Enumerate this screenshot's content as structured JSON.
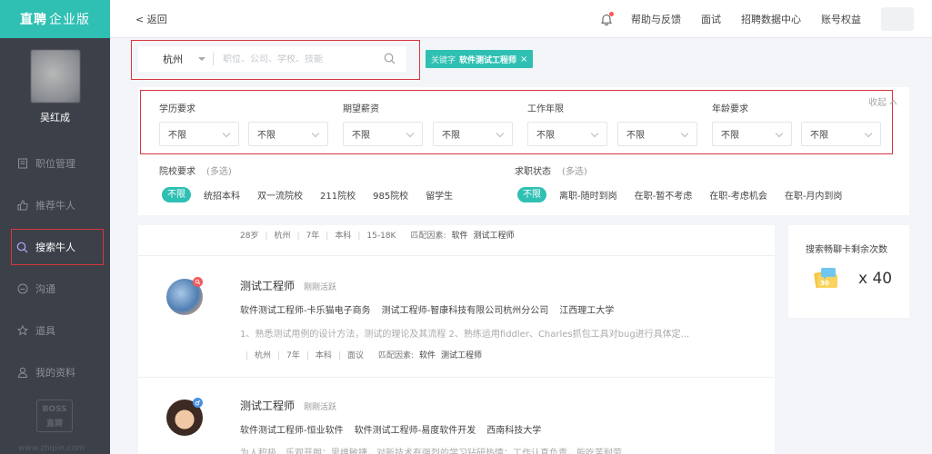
{
  "sidebar": {
    "brand_bold": "直聘",
    "brand_light": "企业版",
    "user_name": "吴红成",
    "items": [
      {
        "label": "职位管理",
        "icon": "document-icon"
      },
      {
        "label": "推荐牛人",
        "icon": "thumbs-up-icon"
      },
      {
        "label": "搜索牛人",
        "icon": "search-icon",
        "active": true
      },
      {
        "label": "沟通",
        "icon": "chat-icon"
      },
      {
        "label": "道具",
        "icon": "star-icon"
      },
      {
        "label": "我的资料",
        "icon": "user-icon"
      }
    ],
    "logo_line1": "BOSS",
    "logo_line2": "直聘",
    "footer_url": "www.zhipin.com"
  },
  "topbar": {
    "back": "< 返回",
    "links": [
      "帮助与反馈",
      "面试",
      "招聘数据中心",
      "账号权益"
    ],
    "bell_icon": "bell-icon"
  },
  "search": {
    "city": "杭州",
    "placeholder": "职位、公司、学校、技能",
    "keyword_label": "关键字",
    "keyword_value": "软件测试工程师",
    "keyword_close": "×"
  },
  "filters": {
    "collapse_label": "收起",
    "groups": [
      {
        "label": "学历要求",
        "selects": [
          "不限",
          "不限"
        ]
      },
      {
        "label": "期望薪资",
        "selects": [
          "不限",
          "不限"
        ]
      },
      {
        "label": "工作年限",
        "selects": [
          "不限",
          "不限"
        ]
      },
      {
        "label": "年龄要求",
        "selects": [
          "不限",
          "不限"
        ]
      }
    ],
    "school": {
      "label": "院校要求",
      "hint": "(多选)",
      "options": [
        "不限",
        "统招本科",
        "双一流院校",
        "211院校",
        "985院校",
        "留学生"
      ]
    },
    "status": {
      "label": "求职状态",
      "hint": "(多选)",
      "options": [
        "不限",
        "离职-随时到岗",
        "在职-暂不考虑",
        "在职-考虑机会",
        "在职-月内到岗"
      ]
    }
  },
  "results": {
    "partial_meta": {
      "age": "28岁",
      "city": "杭州",
      "years": "7年",
      "degree": "本科",
      "salary": "15-18K",
      "match_label": "匹配因素:",
      "keywords": [
        "软件",
        "测试工程师"
      ]
    },
    "candidates": [
      {
        "title": "测试工程师",
        "active": "刚刚活跃",
        "experience": [
          "软件测试工程师-卡乐猫电子商务",
          "测试工程师-智康科技有限公司杭州分公司",
          "江西理工大学"
        ],
        "description": "1、熟悉测试用例的设计方法，测试的理论及其流程 2、熟练运用fiddler、Charles抓包工具对bug进行具体定...",
        "meta": {
          "city": "杭州",
          "years": "7年",
          "degree": "本科",
          "salary": "面议",
          "match_label": "匹配因素:",
          "keywords": [
            "软件",
            "测试工程师"
          ]
        }
      },
      {
        "title": "测试工程师",
        "active": "刚刚活跃",
        "experience": [
          "软件测试工程师-恒业软件",
          "软件测试工程师-易度软件开发",
          "西南科技大学"
        ],
        "description": "为人积极，乐观开朗；思维敏捷，对新技术有强烈的学习钻研热情；工作认真负责，能吃苦耐劳"
      }
    ]
  },
  "card": {
    "title": "搜索畅聊卡剩余次数",
    "count": "x 40",
    "icon": "chat-card-icon"
  },
  "colors": {
    "accent": "#2fc0b3",
    "sidebar": "#3c4049",
    "highlight": "#d9363e"
  }
}
